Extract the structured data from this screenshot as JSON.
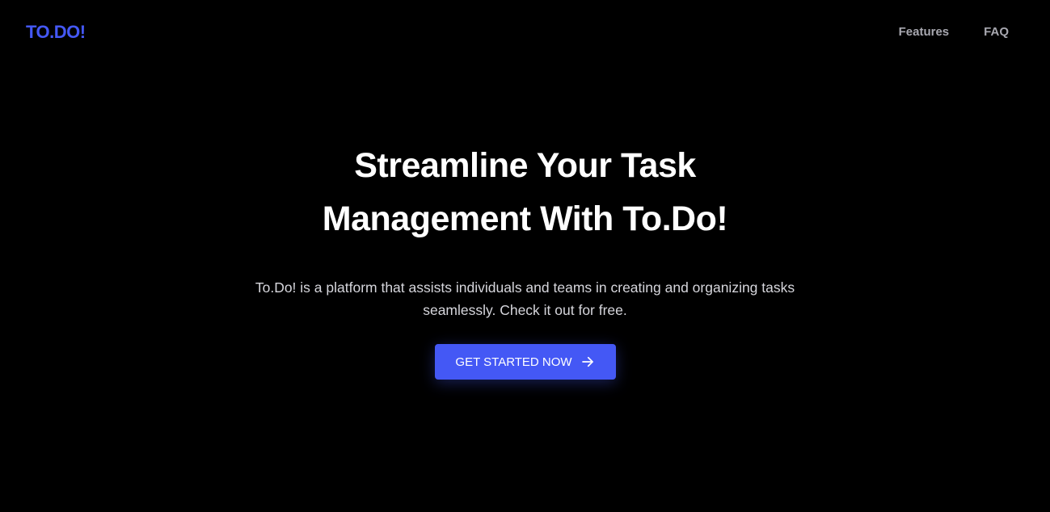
{
  "colors": {
    "background": "#000000",
    "brand": "#4458f5",
    "nav_text": "#a8a8b0",
    "heading": "#ffffff",
    "body_text": "#d6d6dc"
  },
  "header": {
    "logo": "TO.DO!",
    "nav": [
      {
        "label": "Features"
      },
      {
        "label": "FAQ"
      }
    ]
  },
  "hero": {
    "title_line1": "Streamline Your Task",
    "title_line2": "Management With To.Do!",
    "description": "To.Do! is a platform that assists individuals and teams in creating and organizing tasks seamlessly. Check it out for free.",
    "cta_label": "GET STARTED NOW",
    "cta_icon": "arrow-right-icon"
  }
}
